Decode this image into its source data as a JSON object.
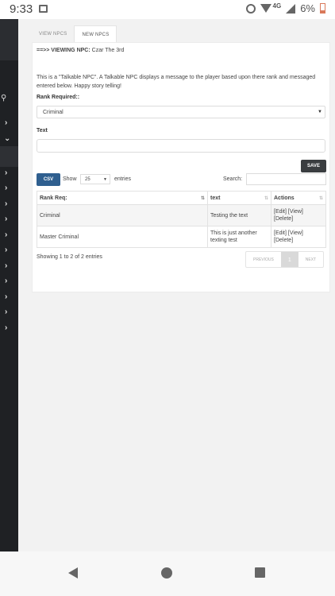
{
  "status_bar": {
    "time": "9:33",
    "network": "4G",
    "battery": "6%"
  },
  "tabs": [
    {
      "label": "VIEW NPCS",
      "active": false
    },
    {
      "label": "NEW NPCS",
      "active": true
    }
  ],
  "viewing": {
    "prefix": "==>> VIEWING NPC:",
    "name": "Czar The 3rd"
  },
  "description": "This is a \"Talkable NPC\". A Talkable NPC displays a message to the player based upon there rank and messaged entered below. Happy story telling!",
  "form": {
    "rank_label": "Rank Required::",
    "rank_value": "Criminal",
    "text_label": "Text",
    "text_value": "",
    "save_label": "SAVE"
  },
  "table_controls": {
    "csv_label": "CSV",
    "show_label": "Show",
    "entries_value": "25",
    "entries_label": "entries",
    "search_label": "Search:"
  },
  "table": {
    "headers": [
      "Rank Req:",
      "text",
      "Actions"
    ],
    "rows": [
      {
        "rank": "Criminal",
        "text": "Testing the text",
        "actions": "[Edit] [View] [Delete]"
      },
      {
        "rank": "Master Criminal",
        "text": "This is just another texting test",
        "actions": "[Edit] [View] [Delete]"
      }
    ]
  },
  "footer": {
    "showing": "Showing 1 to 2 of 2 entries",
    "previous": "PREVIOUS",
    "page": "1",
    "next": "NEXT"
  }
}
